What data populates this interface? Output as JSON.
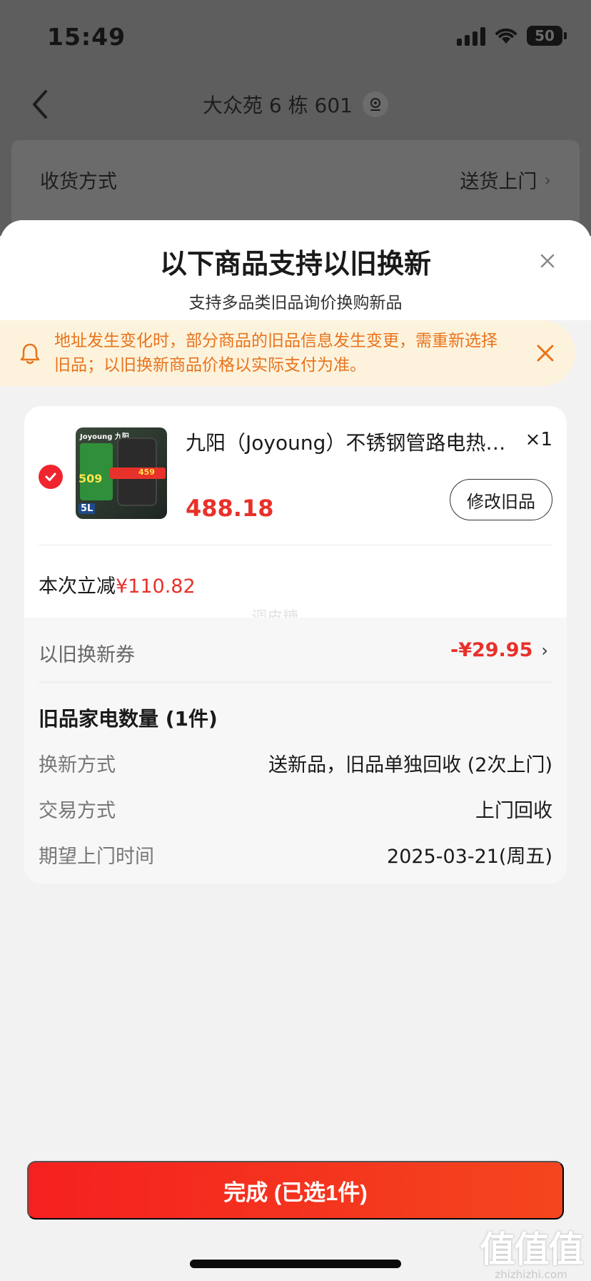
{
  "status_bar": {
    "time": "15:49",
    "battery": "50"
  },
  "nav": {
    "title": "大众苑 6 栋 601"
  },
  "delivery": {
    "label": "收货方式",
    "value": "送货上门"
  },
  "sheet": {
    "title": "以下商品支持以旧换新",
    "subtitle": "支持多品类旧品询价换购新品"
  },
  "notice": {
    "text": "地址发生变化时，部分商品的旧品信息发生变更，需重新选择旧品；以旧换新商品价格以实际支付为准。"
  },
  "product": {
    "image_texts": {
      "brand": "Joyoung 九阳",
      "big": "509",
      "price": "459",
      "capacity": "5L"
    },
    "name": "九阳（Joyoung）不锈钢管路电热水壶家用全自动",
    "qty": "×1",
    "price": "488.18",
    "modify_label": "修改旧品"
  },
  "discount": {
    "label": "本次立减",
    "amount": "¥110.82"
  },
  "watermark": "调皮糖",
  "coupon": {
    "label": "以旧换新券",
    "amount": "-¥29.95"
  },
  "old_items": {
    "title": "旧品家电数量 (1件)",
    "rows": [
      {
        "label": "换新方式",
        "value": "送新品，旧品单独回收 (2次上门)"
      },
      {
        "label": "交易方式",
        "value": "上门回收"
      },
      {
        "label": "期望上门时间",
        "value": "2025-03-21(周五)"
      }
    ]
  },
  "footer": {
    "done_label": "完成 (已选1件)"
  },
  "site_logo": {
    "main": "值值值",
    "sub": "zhizhizhi.com"
  },
  "colors": {
    "accent": "#e8312a",
    "notice_text": "#e8731c",
    "notice_bg": "#fdf3dc"
  },
  "icons": [
    "back-arrow-icon",
    "location-pin-icon",
    "close-icon",
    "bell-icon",
    "check-icon",
    "chevron-right-icon"
  ]
}
